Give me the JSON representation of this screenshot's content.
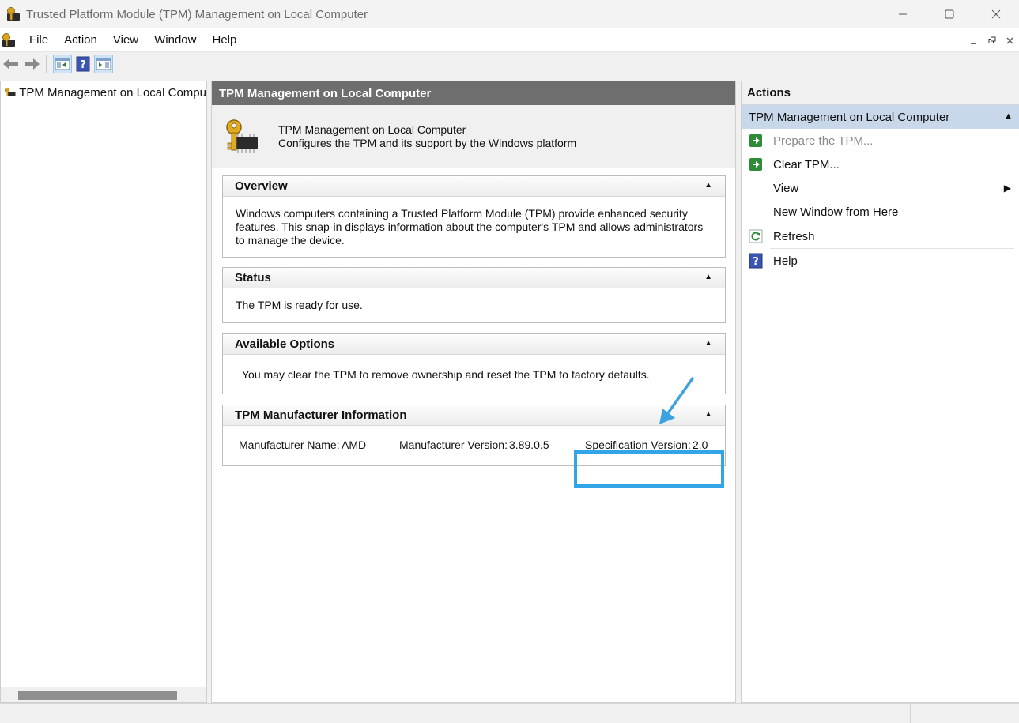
{
  "window": {
    "title": "Trusted Platform Module (TPM) Management on Local Computer",
    "controls": {
      "minimize": "—",
      "maximize": "☐",
      "close": "✕"
    }
  },
  "menubar": {
    "items": [
      "File",
      "Action",
      "View",
      "Window",
      "Help"
    ]
  },
  "tree": {
    "root_label": "TPM Management on Local Compu"
  },
  "center": {
    "header": "TPM Management on Local Computer",
    "intro_title": "TPM Management on Local Computer",
    "intro_desc": "Configures the TPM and its support by the Windows platform",
    "sections": {
      "overview": {
        "title": "Overview",
        "body": "Windows computers containing a Trusted Platform Module (TPM) provide enhanced security features. This snap-in displays information about the computer's TPM and allows administrators to manage the device."
      },
      "status": {
        "title": "Status",
        "body": "The TPM is ready for use."
      },
      "options": {
        "title": "Available Options",
        "body": "You may clear the TPM to remove ownership and reset the TPM to factory defaults."
      },
      "manufacturer": {
        "title": "TPM Manufacturer Information",
        "name_label": "Manufacturer Name:",
        "name_value": "AMD",
        "version_label": "Manufacturer Version:",
        "version_value": "3.89.0.5",
        "spec_label": "Specification Version:",
        "spec_value": "2.0"
      }
    }
  },
  "actions": {
    "title": "Actions",
    "group": "TPM Management on Local Computer",
    "items": [
      {
        "label": "Prepare the TPM...",
        "icon": "green-arrow-icon"
      },
      {
        "label": "Clear TPM...",
        "icon": "green-arrow-icon"
      },
      {
        "label": "View",
        "icon": "none"
      },
      {
        "label": "New Window from Here",
        "icon": "none"
      },
      {
        "label": "Refresh",
        "icon": "refresh-icon"
      },
      {
        "label": "Help",
        "icon": "help-icon"
      }
    ]
  },
  "colors": {
    "highlight": "#33a4e8",
    "center_header_bg": "#6e6e6e",
    "actions_group_bg": "#c8d8ea"
  }
}
